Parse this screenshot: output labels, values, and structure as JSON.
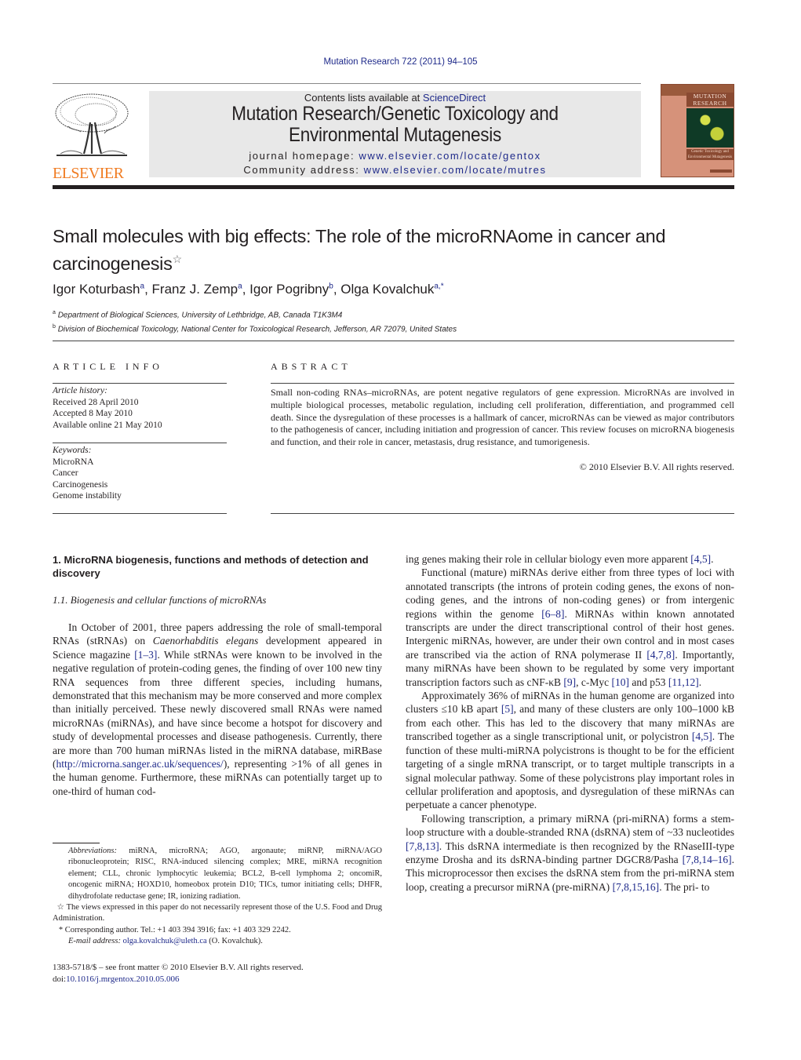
{
  "header": {
    "citation": "Mutation Research 722 (2011) 94–105",
    "publisher_logo": "ELSEVIER",
    "contents_prefix": "Contents lists available at ",
    "contents_link": "ScienceDirect",
    "journal_title_line1": "Mutation Research/Genetic Toxicology and",
    "journal_title_line2": "Environmental Mutagenesis",
    "homepage_label": "journal homepage: ",
    "homepage_url": "www.elsevier.com/locate/gentox",
    "community_label": "Community address: ",
    "community_url": "www.elsevier.com/locate/mutres",
    "cover": {
      "title_line1": "MUTATION",
      "title_line2": "RESEARCH",
      "subtitle": "Genetic Toxicology and Environmental Mutagenesis"
    }
  },
  "article": {
    "title": "Small molecules with big effects: The role of the microRNAome in cancer and carcinogenesis",
    "title_mark": "☆",
    "authors": [
      {
        "name": "Igor Koturbash",
        "sup": "a"
      },
      {
        "name": "Franz J. Zemp",
        "sup": "a"
      },
      {
        "name": "Igor Pogribny",
        "sup": "b"
      },
      {
        "name": "Olga Kovalchuk",
        "sup": "a,*"
      }
    ],
    "affiliations": [
      {
        "mark": "a",
        "text": "Department of Biological Sciences, University of Lethbridge, AB, Canada T1K3M4"
      },
      {
        "mark": "b",
        "text": "Division of Biochemical Toxicology, National Center for Toxicological Research, Jefferson, AR 72079, United States"
      }
    ]
  },
  "article_info": {
    "heading": "ARTICLE INFO",
    "history_label": "Article history:",
    "history": [
      "Received 28 April 2010",
      "Accepted 8 May 2010",
      "Available online 21 May 2010"
    ],
    "keywords_label": "Keywords:",
    "keywords": [
      "MicroRNA",
      "Cancer",
      "Carcinogenesis",
      "Genome instability"
    ]
  },
  "abstract": {
    "heading": "ABSTRACT",
    "text": "Small non-coding RNAs–microRNAs, are potent negative regulators of gene expression. MicroRNAs are involved in multiple biological processes, metabolic regulation, including cell proliferation, differentiation, and programmed cell death. Since the dysregulation of these processes is a hallmark of cancer, microRNAs can be viewed as major contributors to the pathogenesis of cancer, including initiation and progression of cancer. This review focuses on microRNA biogenesis and function, and their role in cancer, metastasis, drug resistance, and tumorigenesis.",
    "copyright": "© 2010 Elsevier B.V. All rights reserved."
  },
  "body": {
    "section_heading": "1.  MicroRNA biogenesis, functions and methods of detection and discovery",
    "subsection_heading": "1.1.  Biogenesis and cellular functions of microRNAs",
    "left_paragraph": {
      "p1": "In October of 2001, three papers addressing the role of small-temporal RNAs (stRNAs) on ",
      "species": "Caenorhabditis elegans",
      "p2": " development appeared in Science magazine ",
      "ref1": "[1–3]",
      "p3": ". While stRNAs were known to be involved in the negative regulation of protein-coding genes, the finding of over 100 new tiny RNA sequences from three different species, including humans, demonstrated that this mechanism may be more conserved and more complex than initially perceived. These newly discovered small RNAs were named microRNAs (miRNAs), and have since become a hotspot for discovery and study of developmental processes and disease pathogenesis. Currently, there are more than 700 human miRNAs listed in the miRNA database, miRBase (",
      "url": "http://microrna.sanger.ac.uk/sequences/",
      "p4": "), representing >1% of all genes in the human genome. Furthermore, these miRNAs can potentially target up to one-third of human cod-"
    },
    "right": {
      "cont_text": "ing genes making their role in cellular biology even more apparent ",
      "cont_ref": "[4,5]",
      "para2": {
        "t1": "Functional (mature) miRNAs derive either from three types of loci with annotated transcripts (the introns of protein coding genes, the exons of non-coding genes, and the introns of non-coding genes) or from intergenic regions within the genome ",
        "r1": "[6–8]",
        "t2": ". MiRNAs within known annotated transcripts are under the direct transcriptional control of their host genes. Intergenic miRNAs, however, are under their own control and in most cases are transcribed via the action of RNA polymerase II ",
        "r2": "[4,7,8]",
        "t3": ". Importantly, many miRNAs have been shown to be regulated by some very important transcription factors such as cNF-κB ",
        "r3": "[9]",
        "t4": ", c-Myc ",
        "r4": "[10]",
        "t5": " and p53 ",
        "r5": "[11,12]",
        "t6": "."
      },
      "para3": {
        "t1": "Approximately 36% of miRNAs in the human genome are organized into clusters ≤10 kB apart ",
        "r1": "[5]",
        "t2": ", and many of these clusters are only 100–1000 kB from each other. This has led to the discovery that many miRNAs are transcribed together as a single transcriptional unit, or polycistron ",
        "r2": "[4,5]",
        "t3": ". The function of these multi-miRNA polycistrons is thought to be for the efficient targeting of a single mRNA transcript, or to target multiple transcripts in a signal molecular pathway. Some of these polycistrons play important roles in cellular proliferation and apoptosis, and dysregulation of these miRNAs can perpetuate a cancer phenotype."
      },
      "para4": {
        "t1": "Following transcription, a primary miRNA (pri-miRNA) forms a stem-loop structure with a double-stranded RNA (dsRNA) stem of ~33 nucleotides ",
        "r1": "[7,8,13]",
        "t2": ". This dsRNA intermediate is then recognized by the RNaseIII-type enzyme Drosha and its dsRNA-binding partner DGCR8/Pasha ",
        "r2": "[7,8,14–16]",
        "t3": ". This microprocessor then excises the dsRNA stem from the pri-miRNA stem loop, creating a precursor miRNA (pre-miRNA) ",
        "r3": "[7,8,15,16]",
        "t4": ". The pri- to"
      }
    }
  },
  "footnotes": {
    "abbrev_label": "Abbreviations:",
    "abbrev_text": " miRNA, microRNA; AGO, argonaute; miRNP, miRNA/AGO ribonucleoprotein; RISC, RNA-induced silencing complex; MRE, miRNA recognition element; CLL, chronic lymphocytic leukemia; BCL2, B-cell lymphoma 2; oncomiR, oncogenic miRNA; HOXD10, homeobox protein D10; TICs, tumor initiating cells; DHFR, dihydrofolate reductase gene; IR, ionizing radiation.",
    "star_mark": "☆",
    "star_note": " The views expressed in this paper do not necessarily represent those of the U.S. Food and Drug Administration.",
    "corr_mark": "*",
    "corr_note": " Corresponding author. Tel.: +1 403 394 3916; fax: +1 403 329 2242.",
    "email_label": "E-mail address: ",
    "email": "olga.kovalchuk@uleth.ca",
    "email_suffix": " (O. Kovalchuk)."
  },
  "front_matter": {
    "issn_line": "1383-5718/$ – see front matter © 2010 Elsevier B.V. All rights reserved.",
    "doi_prefix": "doi:",
    "doi": "10.1016/j.mrgentox.2010.05.006"
  },
  "colors": {
    "link": "#1f2a8a",
    "elsevier_orange": "#f07c22",
    "banner_bg": "#e8e8e8",
    "cover_bg": "#d6927a"
  }
}
